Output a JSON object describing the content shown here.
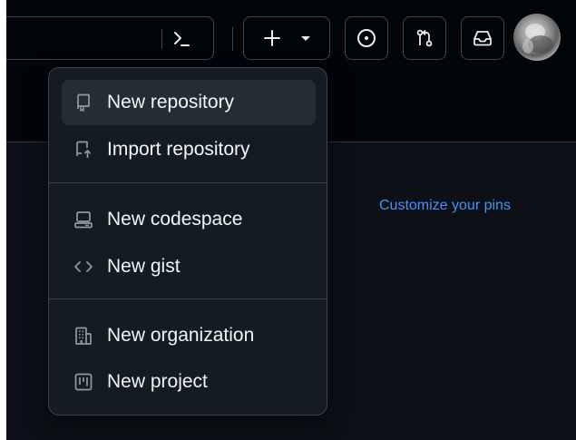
{
  "header": {
    "command_icon": "terminal-prompt-icon",
    "create_button": {
      "plus_icon": "plus-icon",
      "caret_icon": "triangle-down-icon"
    },
    "issues_icon": "issue-opened-icon",
    "pulls_icon": "git-pull-request-icon",
    "inbox_icon": "inbox-icon",
    "avatar": "user-avatar"
  },
  "dashboard": {
    "customize_pins_label": "Customize your pins",
    "link_color": "#4493f8"
  },
  "create_menu": {
    "items": [
      {
        "label": "New repository",
        "icon": "repo-icon",
        "highlighted": true
      },
      {
        "label": "Import repository",
        "icon": "repo-push-icon"
      },
      {
        "label": "New codespace",
        "icon": "codespaces-icon"
      },
      {
        "label": "New gist",
        "icon": "code-icon"
      },
      {
        "label": "New organization",
        "icon": "organization-icon"
      },
      {
        "label": "New project",
        "icon": "project-icon"
      }
    ]
  },
  "colors": {
    "background": "#0d1117",
    "header_background": "#010409",
    "menu_background": "#151b23",
    "menu_highlight": "#262c36",
    "border": "#3d444d",
    "text": "#f0f6fc",
    "icon": "#9198a1"
  }
}
